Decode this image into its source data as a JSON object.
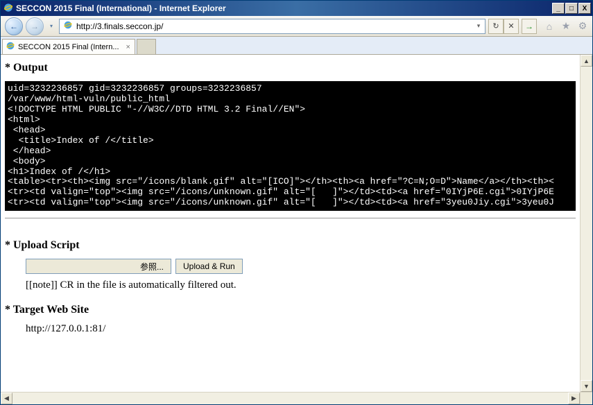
{
  "window": {
    "title": "SECCON 2015 Final (International) - Internet Explorer"
  },
  "navbar": {
    "url": "http://3.finals.seccon.jp/"
  },
  "tab": {
    "label": "SECCON 2015 Final (Intern..."
  },
  "page": {
    "output_heading": "* Output",
    "terminal_text": "uid=3232236857 gid=3232236857 groups=3232236857\n/var/www/html-vuln/public_html\n<!DOCTYPE HTML PUBLIC \"-//W3C//DTD HTML 3.2 Final//EN\">\n<html>\n <head>\n  <title>Index of /</title>\n </head>\n <body>\n<h1>Index of /</h1>\n<table><tr><th><img src=\"/icons/blank.gif\" alt=\"[ICO]\"></th><th><a href=\"?C=N;O=D\">Name</a></th><th><\n<tr><td valign=\"top\"><img src=\"/icons/unknown.gif\" alt=\"[   ]\"></td><td><a href=\"0IYjP6E.cgi\">0IYjP6E\n<tr><td valign=\"top\"><img src=\"/icons/unknown.gif\" alt=\"[   ]\"></td><td><a href=\"3yeu0Jiy.cgi\">3yeu0J",
    "upload_heading": "* Upload Script",
    "browse_label": "参照...",
    "upload_run_label": "Upload & Run",
    "note_text": "[[note]]  CR in the file is automatically filtered out.",
    "target_heading": "* Target Web Site",
    "target_url": "http://127.0.0.1:81/"
  },
  "icons": {
    "minimize": "_",
    "maximize": "□",
    "close": "X",
    "back_arrow": "←",
    "forward_arrow": "→",
    "dropdown": "▾",
    "refresh": "↻",
    "stop": "✕",
    "go": "→",
    "home": "⌂",
    "star": "★",
    "gear": "⚙",
    "tab_close": "×",
    "up": "▲",
    "down": "▼",
    "left": "◀",
    "right": "▶"
  }
}
